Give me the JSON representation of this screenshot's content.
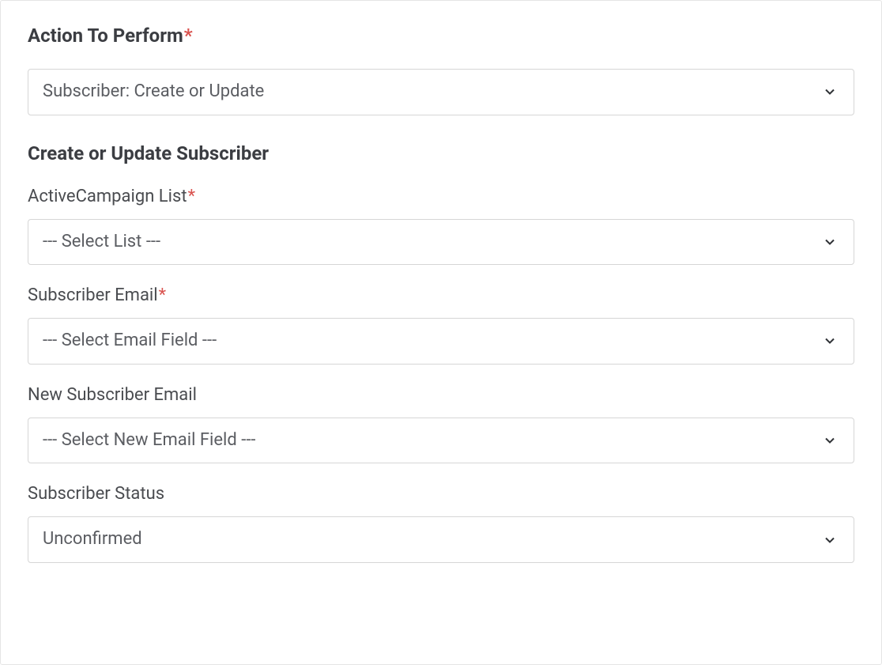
{
  "form": {
    "action": {
      "label": "Action To Perform",
      "required": true,
      "selected": "Subscriber: Create or Update"
    },
    "subsection_title": "Create or Update Subscriber",
    "list": {
      "label": "ActiveCampaign List",
      "required": true,
      "selected": "--- Select List ---"
    },
    "email": {
      "label": "Subscriber Email",
      "required": true,
      "selected": "--- Select Email Field ---"
    },
    "new_email": {
      "label": "New Subscriber Email",
      "required": false,
      "selected": "--- Select New Email Field ---"
    },
    "status": {
      "label": "Subscriber Status",
      "required": false,
      "selected": "Unconfirmed"
    }
  }
}
